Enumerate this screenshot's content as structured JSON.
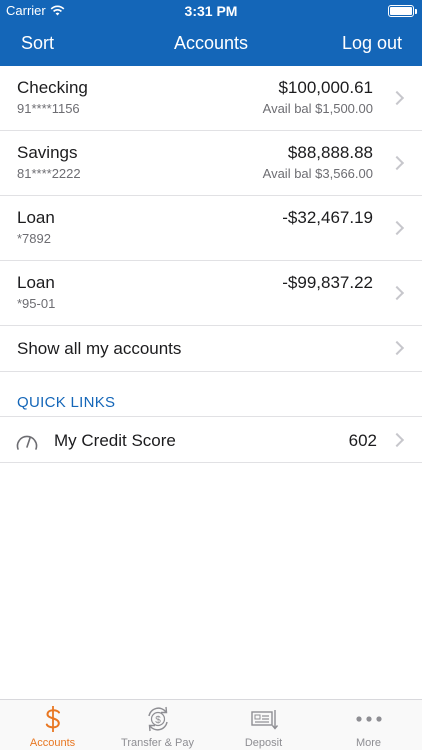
{
  "status_bar": {
    "carrier": "Carrier",
    "time": "3:31 PM"
  },
  "nav": {
    "left": "Sort",
    "title": "Accounts",
    "right": "Log out"
  },
  "accounts": [
    {
      "name": "Checking",
      "number": "91****1156",
      "balance": "$100,000.61",
      "available": "Avail bal $1,500.00"
    },
    {
      "name": "Savings",
      "number": "81****2222",
      "balance": "$88,888.88",
      "available": "Avail bal $3,566.00"
    },
    {
      "name": "Loan",
      "number": "*7892",
      "balance": "-$32,467.19",
      "available": ""
    },
    {
      "name": "Loan",
      "number": "*95-01",
      "balance": "-$99,837.22",
      "available": ""
    }
  ],
  "show_all": "Show all my accounts",
  "quick_links": {
    "header": "QUICK LINKS",
    "items": [
      {
        "label": "My Credit Score",
        "value": "602",
        "icon": "gauge-icon"
      }
    ]
  },
  "tabs": [
    {
      "label": "Accounts",
      "icon": "dollar-icon",
      "active": true
    },
    {
      "label": "Transfer & Pay",
      "icon": "transfer-icon",
      "active": false
    },
    {
      "label": "Deposit",
      "icon": "deposit-check-icon",
      "active": false
    },
    {
      "label": "More",
      "icon": "more-dots-icon",
      "active": false
    }
  ],
  "colors": {
    "brand_blue": "#1466b8",
    "active_tab": "#e87722",
    "chevron": "#c7c7cc"
  }
}
